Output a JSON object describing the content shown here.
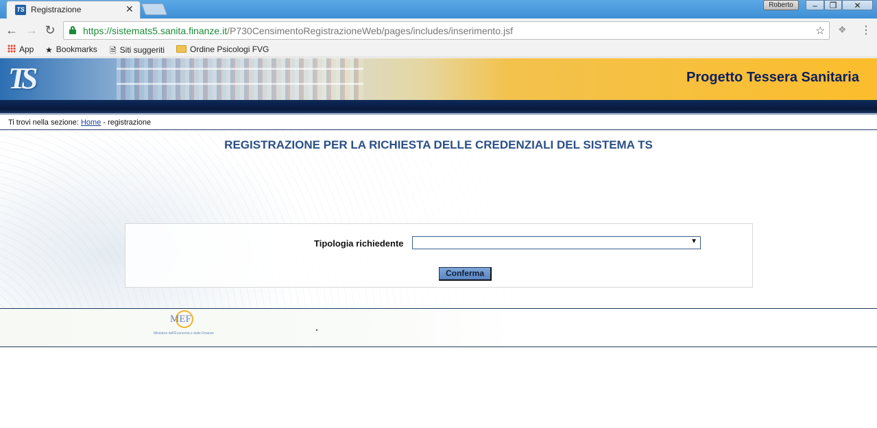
{
  "browser": {
    "tab_title": "Registrazione",
    "tab_favicon_text": "TS",
    "tab_close": "✕",
    "user_name": "Roberto",
    "url_host": "https://sistemats5.sanita.finanze.it",
    "url_path": "/P730CensimentoRegistrazioneWeb/pages/includes/inserimento.jsf",
    "icons": [
      "back-icon",
      "forward-icon",
      "reload-icon",
      "lock-icon",
      "star-icon",
      "extension-icon",
      "menu-icon"
    ]
  },
  "bookmarks": {
    "apps": "App",
    "bookmarks": "Bookmarks",
    "suggested": "Siti suggeriti",
    "folder": "Ordine Psicologi FVG"
  },
  "header": {
    "logo": "TS",
    "title": "Progetto Tessera Sanitaria"
  },
  "breadcrumb": {
    "prefix": "Ti trovi nella sezione:",
    "home": "Home",
    "separator": "-",
    "current": "registrazione"
  },
  "main": {
    "title": "REGISTRAZIONE PER LA RICHIESTA DELLE CREDENZIALI DEL SISTEMA TS",
    "field_label": "Tipologia richiedente",
    "select_value": "",
    "confirm_label": "Conferma"
  },
  "footer": {
    "logo_text": "MEF",
    "logo_caption": "Ministero dell'Economia e delle Finanze"
  },
  "colors": {
    "title_blue": "#2a4f86",
    "banner_title": "#0d1f5c",
    "button_blue": "#5a86c3",
    "navy": "#0e2a58"
  }
}
